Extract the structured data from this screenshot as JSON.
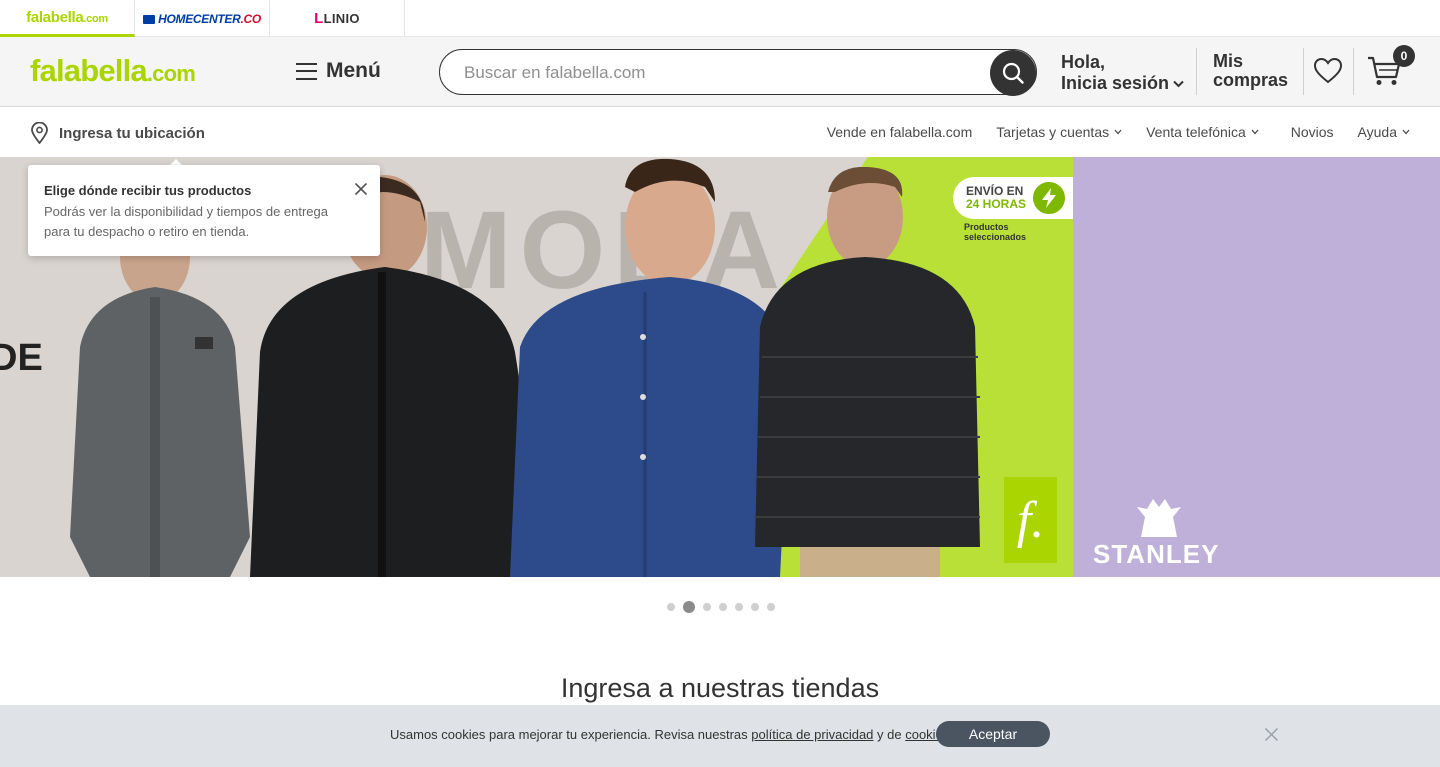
{
  "brands": [
    {
      "name": "falabella",
      "suffix": ".com"
    },
    {
      "name": "HOMECENTER",
      "suffix": ".CO"
    },
    {
      "name": "LINIO",
      "mark": "L"
    }
  ],
  "header": {
    "logo_main": "falabella",
    "logo_suffix": ".com",
    "menu_label": "Menú",
    "search_placeholder": "Buscar en falabella.com",
    "login_line1": "Hola,",
    "login_line2": "Inicia sesión",
    "orders_line1": "Mis",
    "orders_line2": "compras",
    "cart_count": "0"
  },
  "subnav": {
    "location": "Ingresa tu ubicación",
    "links": [
      {
        "label": "Vende en falabella.com",
        "dropdown": false
      },
      {
        "label": "Tarjetas y cuentas",
        "dropdown": true
      },
      {
        "label": "Venta telefónica",
        "dropdown": true
      },
      {
        "label": "Novios",
        "dropdown": false
      },
      {
        "label": "Ayuda",
        "dropdown": true
      }
    ]
  },
  "hero": {
    "banner_word": "MODA",
    "partial_word": "DE",
    "promo_line1": "ENVÍO EN",
    "promo_line2": "24 HORAS",
    "promo_sub": "Productos seleccionados",
    "side_brand": "STANLEY",
    "badge_letter": "f.",
    "slide_count": 7,
    "active_slide": 2
  },
  "popup": {
    "title": "Elige dónde recibir tus productos",
    "body": "Podrás ver la disponibilidad y tiempos de entrega para tu despacho o retiro en tienda."
  },
  "section": {
    "title": "Ingresa a nuestras tiendas"
  },
  "cookie": {
    "text_before": "Usamos cookies para mejorar tu experiencia. Revisa nuestras ",
    "privacy_link": "política de privacidad",
    "text_mid": " y de ",
    "cookies_link": "cookies",
    "text_end": ".",
    "accept_label": "Aceptar"
  },
  "colors": {
    "brand_green": "#aad500",
    "dark": "#333333",
    "cookie_bg": "#dfe2e6",
    "accept_bg": "#4a5561"
  }
}
